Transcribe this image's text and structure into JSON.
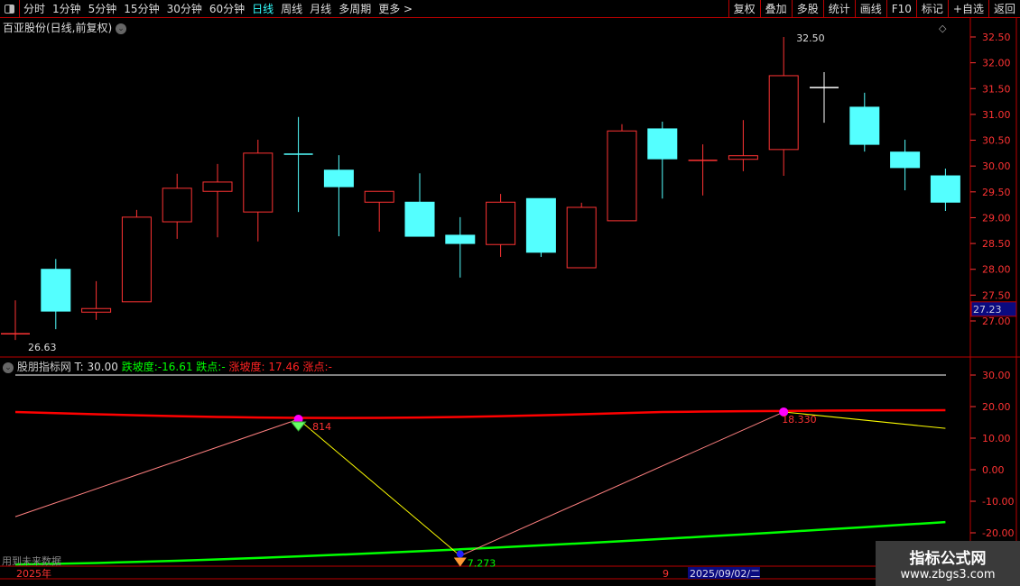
{
  "toolbar": {
    "periods": [
      "分时",
      "1分钟",
      "5分钟",
      "15分钟",
      "30分钟",
      "60分钟",
      "日线",
      "周线",
      "月线",
      "多周期",
      "更多 >"
    ],
    "active": "日线",
    "right_buttons": [
      "复权",
      "叠加",
      "多股",
      "统计",
      "画线",
      "F10",
      "标记",
      "+自选",
      "返回"
    ]
  },
  "stock_title": "百亚股份(日线,前复权)",
  "price_axis": {
    "ticks": [
      "32.50",
      "32.00",
      "31.50",
      "31.00",
      "30.50",
      "30.00",
      "29.50",
      "29.00",
      "28.50",
      "28.00",
      "27.50",
      "27.00"
    ],
    "current": "27.23"
  },
  "annotations": {
    "high": "32.50",
    "low": "26.63"
  },
  "candles": [
    [
      26.75,
      27.4,
      26.63,
      26.75
    ],
    [
      28.0,
      28.2,
      26.84,
      27.19
    ],
    [
      27.17,
      27.77,
      27.02,
      27.24
    ],
    [
      27.37,
      29.15,
      27.37,
      29.01
    ],
    [
      28.92,
      29.85,
      28.59,
      29.57
    ],
    [
      29.51,
      30.04,
      28.62,
      29.69
    ],
    [
      29.11,
      30.51,
      28.54,
      30.25
    ],
    [
      30.23,
      30.95,
      29.11,
      30.23
    ],
    [
      29.92,
      30.21,
      28.64,
      29.6
    ],
    [
      29.3,
      29.51,
      28.73,
      29.51
    ],
    [
      29.3,
      29.86,
      28.64,
      28.64
    ],
    [
      28.66,
      29.01,
      27.84,
      28.5
    ],
    [
      28.48,
      29.46,
      28.24,
      29.3
    ],
    [
      29.37,
      29.37,
      28.24,
      28.33
    ],
    [
      28.03,
      29.29,
      28.03,
      29.2
    ],
    [
      28.94,
      30.81,
      28.94,
      30.68
    ],
    [
      30.72,
      30.86,
      29.37,
      30.14
    ],
    [
      30.11,
      30.42,
      29.43,
      30.11
    ],
    [
      30.13,
      30.89,
      29.9,
      30.2
    ],
    [
      30.32,
      32.5,
      29.81,
      31.75
    ],
    [
      31.52,
      31.82,
      30.84,
      31.52
    ],
    [
      31.14,
      31.42,
      30.28,
      30.42
    ],
    [
      30.27,
      30.51,
      29.53,
      29.97
    ],
    [
      29.81,
      29.95,
      29.13,
      29.3
    ]
  ],
  "indicator": {
    "name": "股朋指标网",
    "t": "T: 30.00",
    "down_slope": "跌坡度:-16.61",
    "down_point": "跌点:-",
    "up_slope": "涨坡度: 17.46",
    "up_point": "涨点:-",
    "ticks": [
      "30.00",
      "20.00",
      "10.00",
      "0.00",
      "-10.00",
      "-20.00"
    ],
    "labels": {
      "peak1": ".814",
      "trough": "7.273",
      "peak2": "18.330"
    },
    "zigzag": [
      [
        0,
        -14.9
      ],
      [
        7,
        16.0
      ],
      [
        11,
        -27.3
      ],
      [
        19,
        18.3
      ],
      [
        23,
        13.1
      ]
    ],
    "colors": {
      "up": "#ff3333",
      "down": "#54ffff",
      "red_line": "#ff0000",
      "green_line": "#00ff00",
      "zigzag": "#ff8080",
      "yellow": "#ffff00"
    }
  },
  "future_note": "用到未来数据",
  "time_axis": {
    "year": "2025年",
    "month": "9",
    "cursor": "2025/09/02/二"
  },
  "watermark": {
    "name": "指标公式网",
    "url": "www.zbgs3.com"
  }
}
